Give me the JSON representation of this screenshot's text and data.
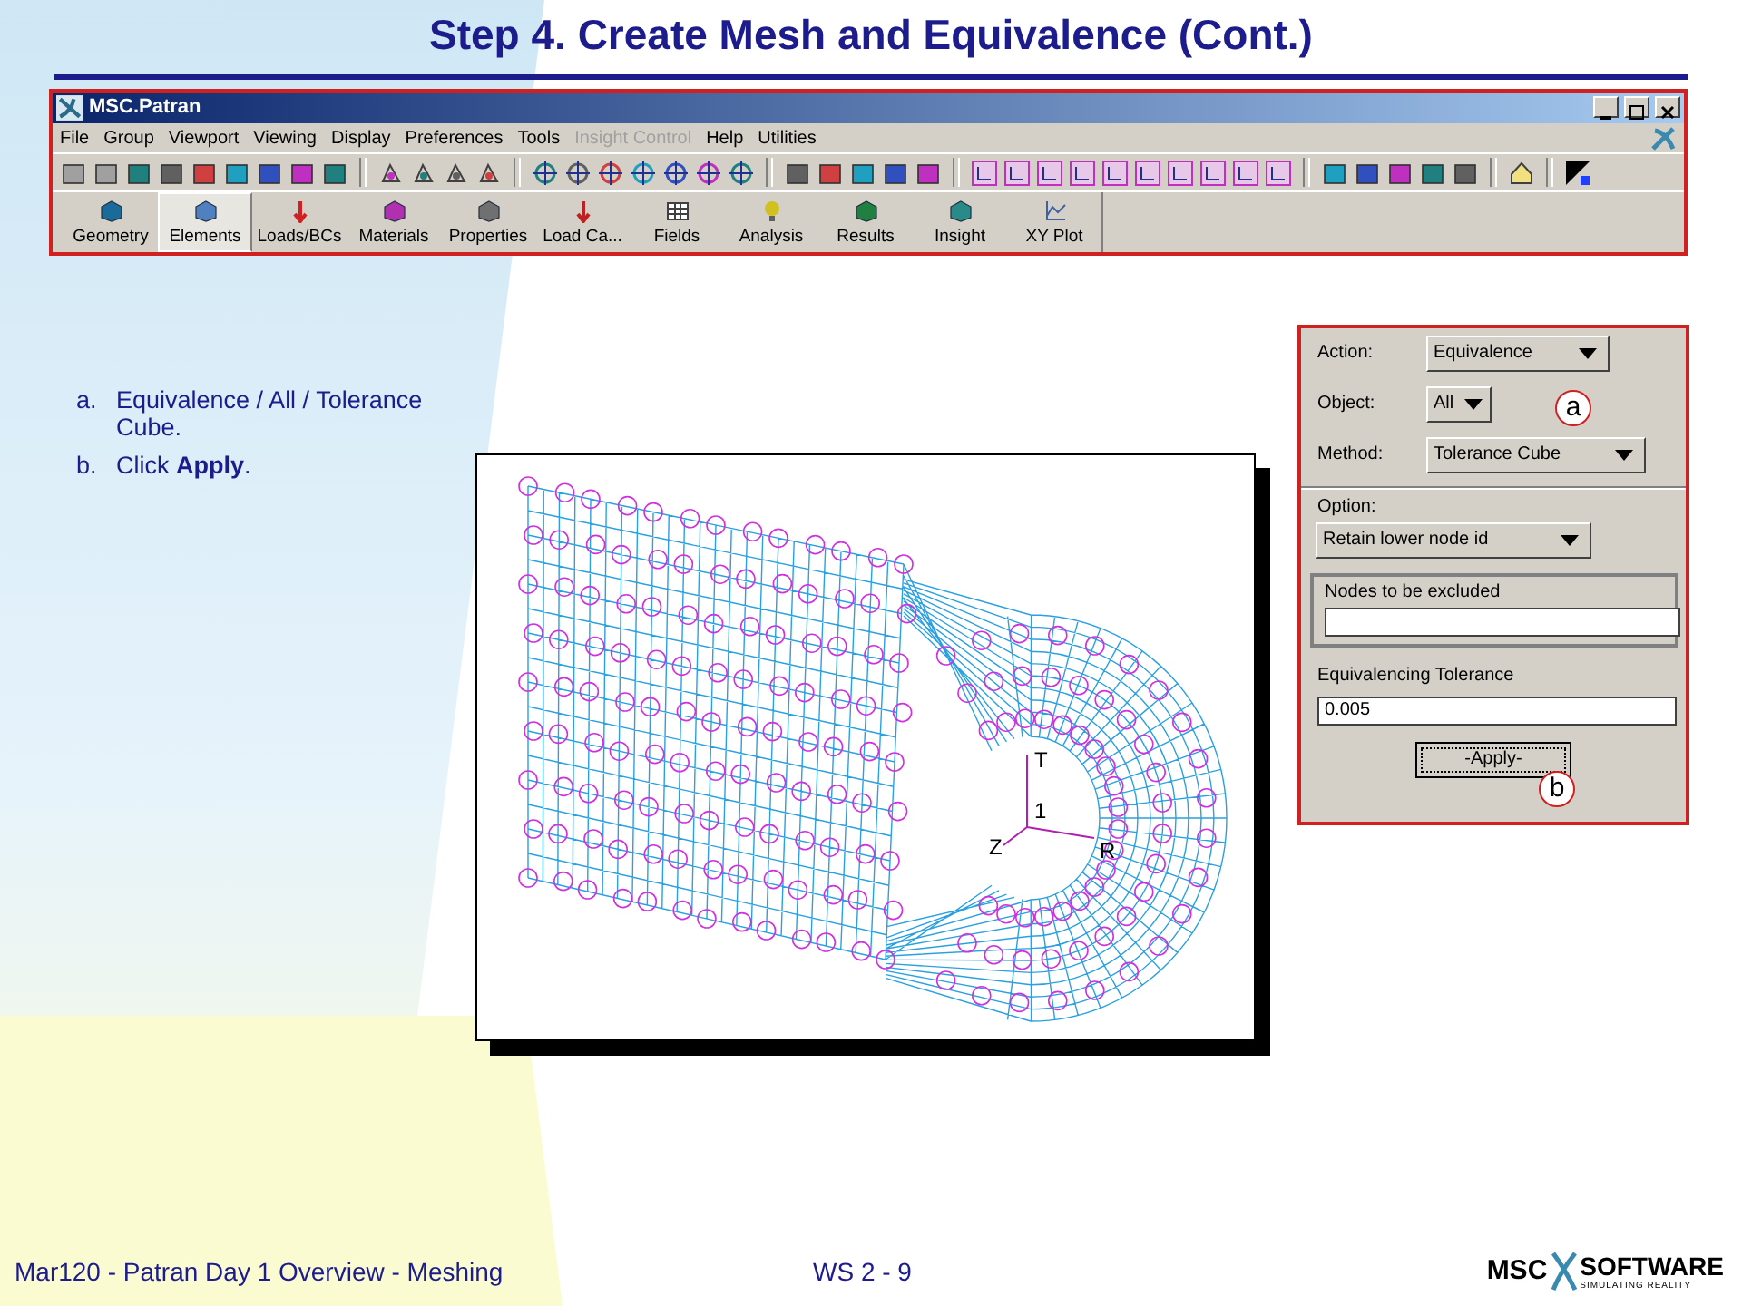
{
  "slide": {
    "title": "Step 4.  Create Mesh and Equivalence (Cont.)"
  },
  "app_window": {
    "title": "MSC.Patran",
    "menu": [
      {
        "label": "File",
        "disabled": false
      },
      {
        "label": "Group",
        "disabled": false
      },
      {
        "label": "Viewport",
        "disabled": false
      },
      {
        "label": "Viewing",
        "disabled": false
      },
      {
        "label": "Display",
        "disabled": false
      },
      {
        "label": "Preferences",
        "disabled": false
      },
      {
        "label": "Tools",
        "disabled": false
      },
      {
        "label": "Insight Control",
        "disabled": true
      },
      {
        "label": "Help",
        "disabled": false
      },
      {
        "label": "Utilities",
        "disabled": false
      }
    ],
    "app_tabs": [
      {
        "label": "Geometry",
        "selected": false
      },
      {
        "label": "Elements",
        "selected": true
      },
      {
        "label": "Loads/BCs",
        "selected": false
      },
      {
        "label": "Materials",
        "selected": false
      },
      {
        "label": "Properties",
        "selected": false
      },
      {
        "label": "Load Ca...",
        "selected": false
      },
      {
        "label": "Fields",
        "selected": false
      },
      {
        "label": "Analysis",
        "selected": false
      },
      {
        "label": "Results",
        "selected": false
      },
      {
        "label": "Insight",
        "selected": false
      },
      {
        "label": "XY Plot",
        "selected": false
      }
    ]
  },
  "instructions": [
    {
      "marker": "a.",
      "text": "Equivalence / All / Tolerance Cube."
    },
    {
      "marker": "b.",
      "text": "Click **Apply**."
    }
  ],
  "viewport": {
    "triad_labels": [
      "T",
      "1",
      "Z",
      "R"
    ]
  },
  "panel": {
    "selectors": [
      {
        "label": "Action:",
        "value": "Equivalence"
      },
      {
        "label": "Object:",
        "value": "All"
      },
      {
        "label": "Method:",
        "value": "Tolerance Cube"
      }
    ],
    "option": {
      "label": "Option:",
      "value": "Retain lower node id"
    },
    "excluded_nodes": {
      "label": "Nodes to be excluded"
    },
    "tolerance": {
      "label": "Equivalencing Tolerance",
      "value": "0.005"
    },
    "apply_button": "-Apply-",
    "callouts": [
      "a",
      "b"
    ]
  },
  "footer": {
    "course": "Mar120 - Patran Day 1 Overview - Meshing",
    "page": "WS 2 - 9",
    "logo": {
      "brand": "MSC",
      "word": "SOFTWARE",
      "tagline": "SIMULATING REALITY"
    }
  }
}
